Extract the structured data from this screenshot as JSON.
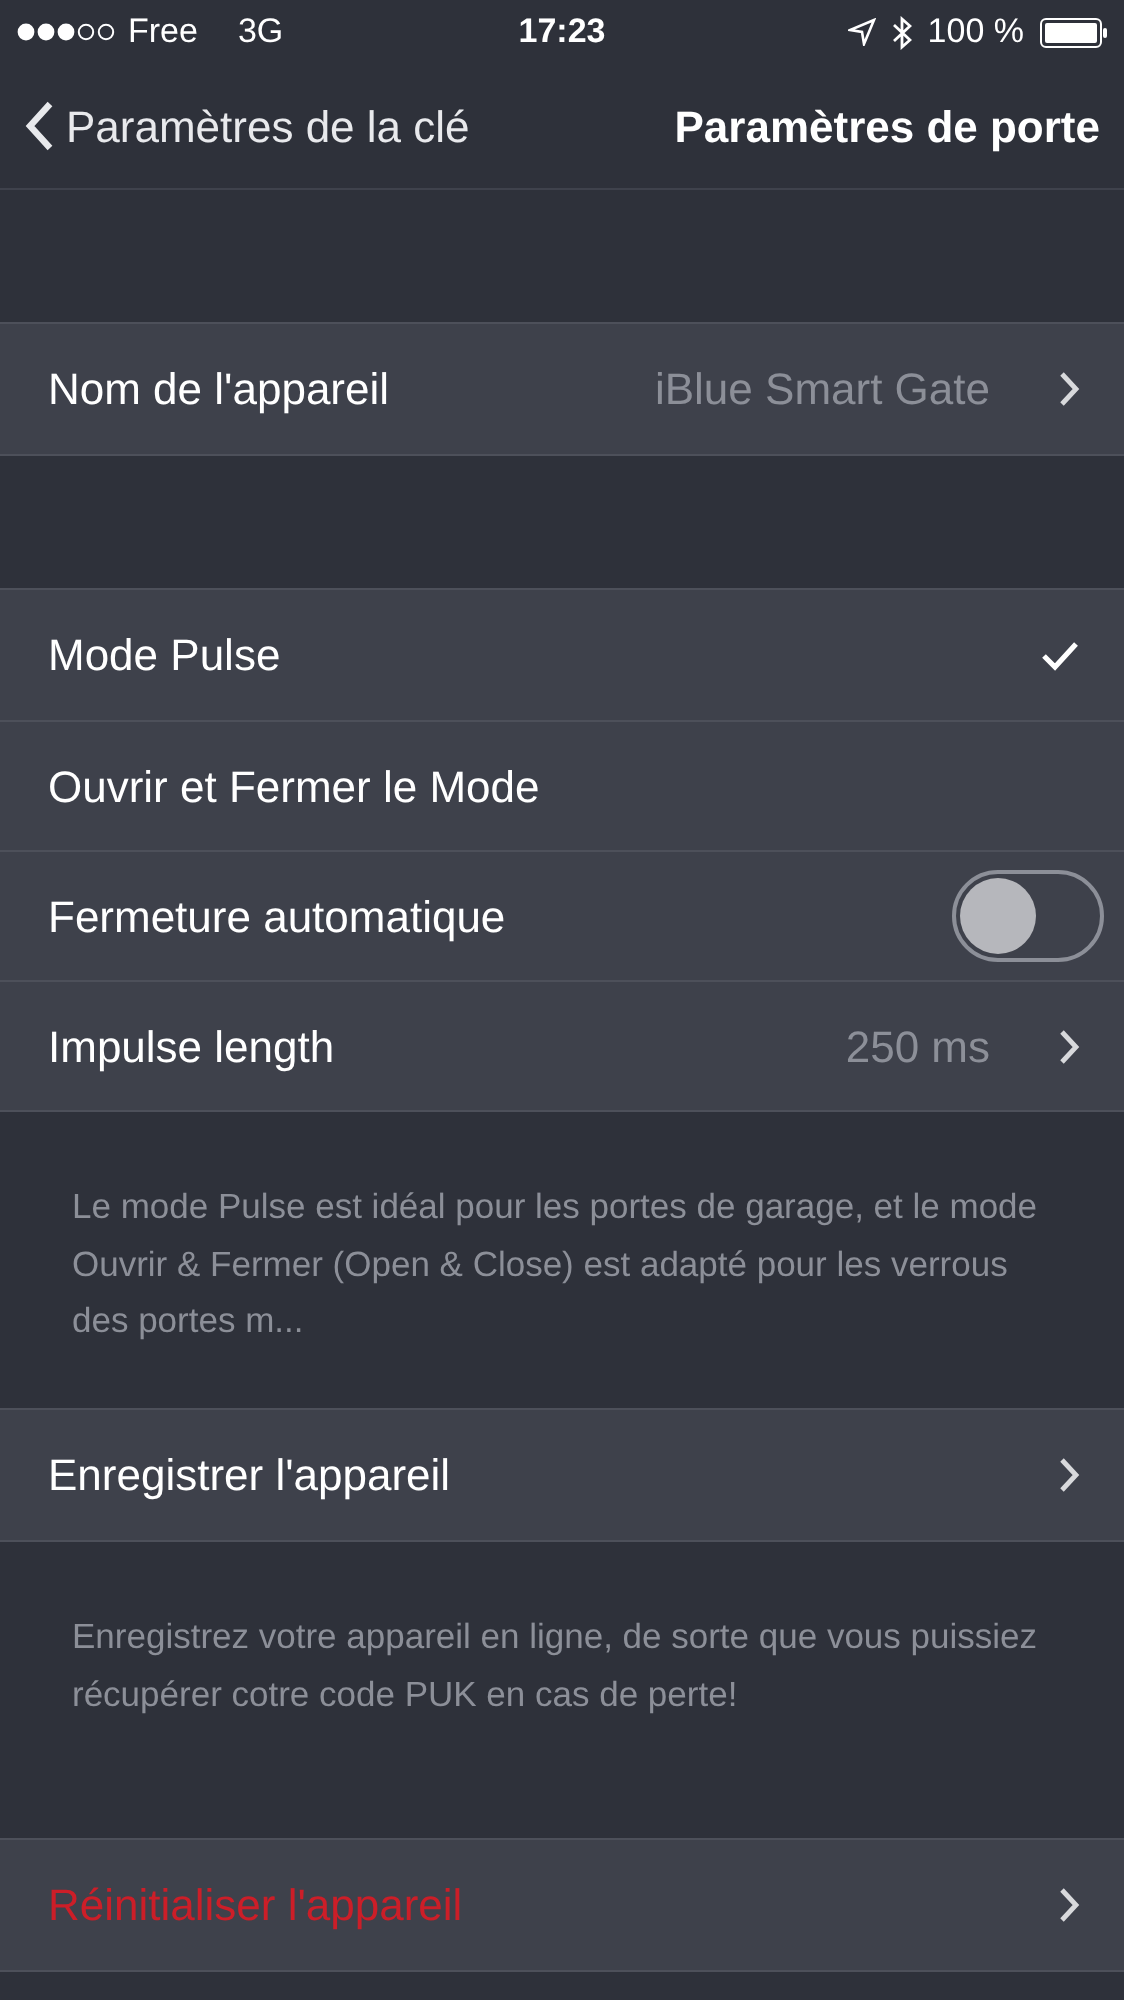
{
  "status_bar": {
    "carrier": "Free",
    "network": "3G",
    "time": "17:23",
    "battery": "100 %"
  },
  "nav_bar": {
    "back_label": "Paramètres de la clé",
    "title": "Paramètres de porte"
  },
  "sections": [
    {
      "rows": [
        {
          "kind": "detail",
          "label": "Nom de l'appareil",
          "value": "iBlue Smart Gate"
        }
      ]
    },
    {
      "rows": [
        {
          "kind": "check",
          "label": "Mode Pulse",
          "checked": true
        },
        {
          "kind": "check",
          "label": "Ouvrir et Fermer le Mode",
          "checked": false
        },
        {
          "kind": "toggle",
          "label": "Fermeture automatique",
          "on": false
        },
        {
          "kind": "detail",
          "label": "Impulse length",
          "value": "250 ms"
        }
      ],
      "footer": "Le mode Pulse est idéal pour les portes de garage, et le mode Ouvrir & Fermer (Open & Close) est adapté pour les verrous des portes m..."
    },
    {
      "rows": [
        {
          "kind": "detail",
          "label": "Enregistrer l'appareil"
        }
      ],
      "footer": "Enregistrez votre appareil en ligne, de sorte que vous puissiez récupérer cotre code PUK en cas de perte!"
    },
    {
      "rows": [
        {
          "kind": "danger",
          "label": "Réinitialiser l'appareil"
        }
      ]
    }
  ]
}
